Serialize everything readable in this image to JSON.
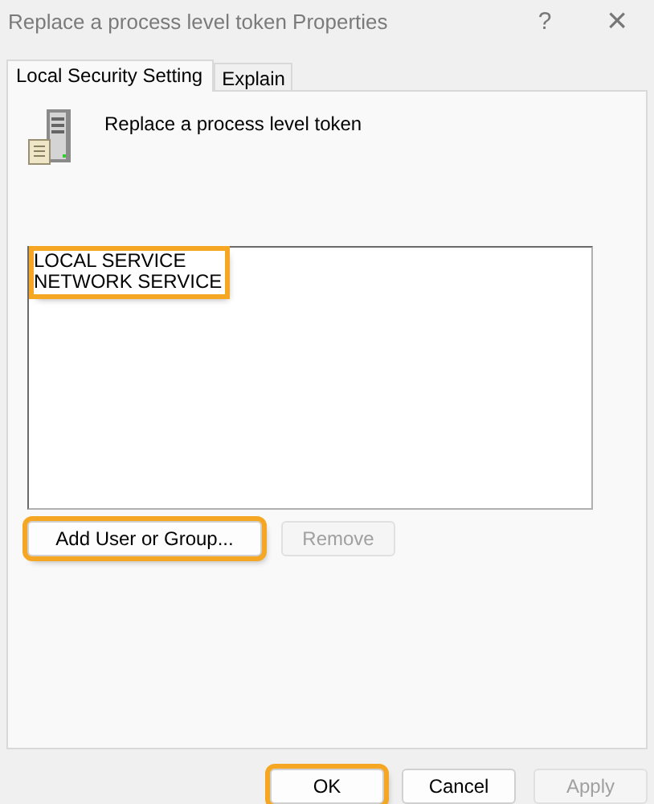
{
  "window": {
    "title": "Replace a process level token Properties",
    "help": "?",
    "close": "×"
  },
  "tabs": [
    {
      "label": "Local Security Setting",
      "selected": true
    },
    {
      "label": "Explain",
      "selected": false
    }
  ],
  "policy": {
    "name": "Replace a process level token"
  },
  "accounts": {
    "highlighted": true,
    "items": [
      {
        "label": "LOCAL SERVICE"
      },
      {
        "label": "NETWORK SERVICE"
      }
    ]
  },
  "list_buttons": [
    {
      "label": "Add User or Group...",
      "disabled": false,
      "highlighted": true
    },
    {
      "label": "Remove",
      "disabled": true,
      "highlighted": false
    }
  ],
  "dialog_buttons": [
    {
      "label": "OK",
      "disabled": false,
      "highlighted": true
    },
    {
      "label": "Cancel",
      "disabled": false,
      "highlighted": false
    },
    {
      "label": "Apply",
      "disabled": true,
      "highlighted": false
    }
  ]
}
